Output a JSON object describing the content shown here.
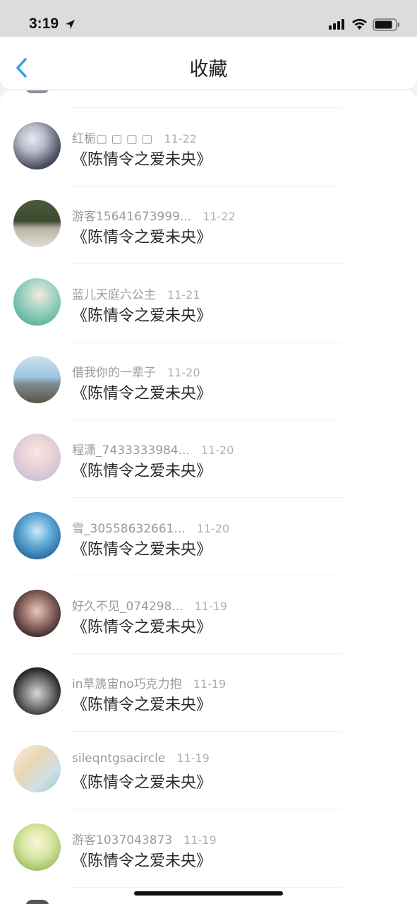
{
  "status": {
    "time": "3:19"
  },
  "nav": {
    "title": "收藏",
    "back_icon": "chevron-left-icon",
    "accent": "#2aa0e6"
  },
  "items": [
    {
      "user": "红栀▢ ▢ ▢ ▢",
      "date": "11-22",
      "title": "《陈情令之爱未央》"
    },
    {
      "user": "游客15641673999...",
      "date": "11-22",
      "title": "《陈情令之爱未央》"
    },
    {
      "user": "蓝儿天庭六公主",
      "date": "11-21",
      "title": "《陈情令之爱未央》"
    },
    {
      "user": "借我你的一辈子",
      "date": "11-20",
      "title": "《陈情令之爱未央》"
    },
    {
      "user": "程潇_7433333984...",
      "date": "11-20",
      "title": "《陈情令之爱未央》"
    },
    {
      "user": "雪_30558632661...",
      "date": "11-20",
      "title": "《陈情令之爱未央》"
    },
    {
      "user": "好久不见_074298...",
      "date": "11-19",
      "title": "《陈情令之爱未央》"
    },
    {
      "user": "in草篪宙no巧克力抱",
      "date": "11-19",
      "title": "《陈情令之爱未央》"
    },
    {
      "user": "sileqntgsacircle",
      "date": "11-19",
      "title": "《陈情令之爱未央》"
    },
    {
      "user": "游客1037043873",
      "date": "11-19",
      "title": "《陈情令之爱未央》"
    }
  ]
}
